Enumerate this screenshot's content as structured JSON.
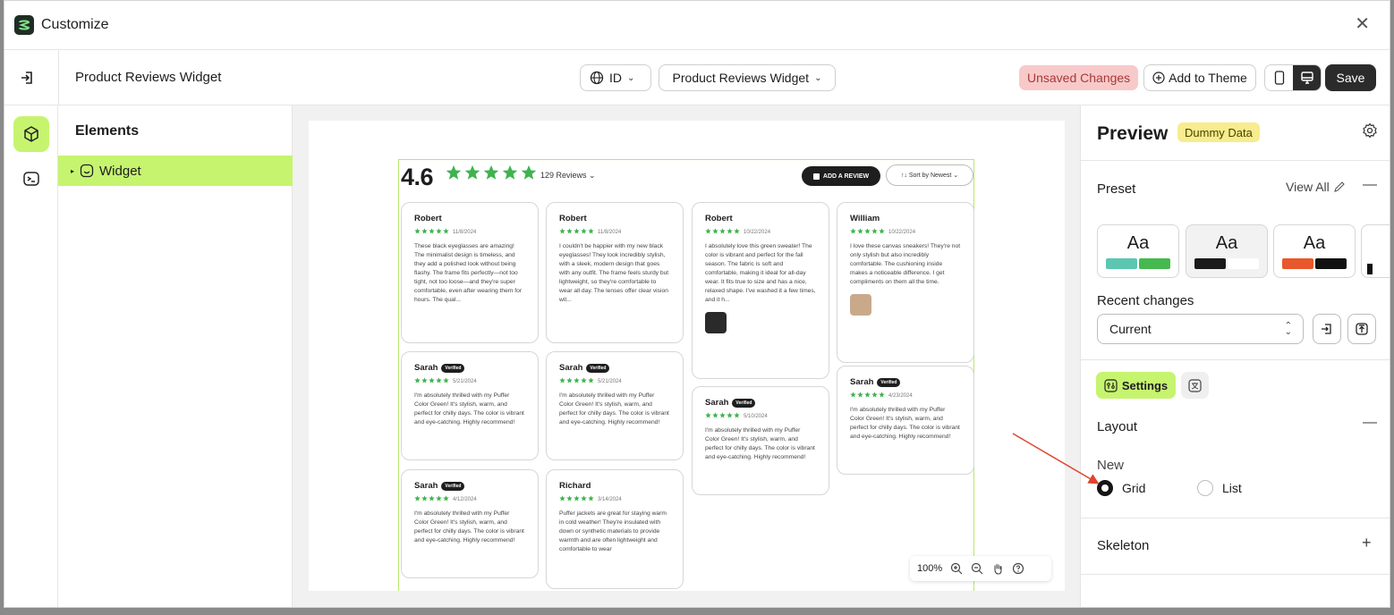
{
  "window": {
    "title": "Customize"
  },
  "header": {
    "widget_name": "Product Reviews Widget",
    "language": "ID",
    "widget_select": "Product Reviews Widget",
    "unsaved": "Unsaved Changes",
    "add_to_theme": "Add to Theme",
    "save": "Save"
  },
  "elements": {
    "title": "Elements",
    "tree": [
      {
        "label": "Widget"
      }
    ]
  },
  "widget": {
    "rating": "4.6",
    "review_count": "129 Reviews",
    "add_review": "ADD A REVIEW",
    "sort": "Sort by Newest",
    "verified_label": "Verified",
    "star_color": "#3fb34f",
    "reviews": [
      {
        "name": "Robert",
        "date": "11/8/2024",
        "text": "These black eyeglasses are amazing! The minimalist design is timeless, and they add a polished look without being flashy. The frame fits perfectly—not too tight, not too loose—and they're super comfortable, even after wearing them for hours. The qual..."
      },
      {
        "name": "Robert",
        "date": "11/8/2024",
        "text": "I couldn't be happier with my new black eyeglasses! They look incredibly stylish, with a sleek, modern design that goes with any outfit. The frame feels sturdy but lightweight, so they're comfortable to wear all day. The lenses offer clear vision wit..."
      },
      {
        "name": "Robert",
        "date": "10/22/2024",
        "text": "I absolutely love this green sweater! The color is vibrant and perfect for the fall season. The fabric is soft and comfortable, making it ideal for all-day wear. It fits true to size and has a nice, relaxed shape. I've washed it a few times, and it h..."
      },
      {
        "name": "William",
        "date": "10/22/2024",
        "text": "I love these canvas sneakers! They're not only stylish but also incredibly comfortable. The cushioning inside makes a noticeable difference. I get compliments on them all the time."
      },
      {
        "name": "Sarah",
        "date": "5/21/2024",
        "text": "I'm absolutely thrilled with my Puffer Color Green! It's stylish, warm, and perfect for chilly days. The color is vibrant and eye-catching. Highly recommend!"
      },
      {
        "name": "Sarah",
        "date": "5/21/2024",
        "text": "I'm absolutely thrilled with my Puffer Color Green! It's stylish, warm, and perfect for chilly days. The color is vibrant and eye-catching. Highly recommend!"
      },
      {
        "name": "Sarah",
        "date": "5/10/2024",
        "text": "I'm absolutely thrilled with my Puffer Color Green! It's stylish, warm, and perfect for chilly days. The color is vibrant and eye-catching. Highly recommend!"
      },
      {
        "name": "Sarah",
        "date": "4/23/2024",
        "text": "I'm absolutely thrilled with my Puffer Color Green! It's stylish, warm, and perfect for chilly days. The color is vibrant and eye-catching. Highly recommend!"
      },
      {
        "name": "Sarah",
        "date": "4/12/2024",
        "text": "I'm absolutely thrilled with my Puffer Color Green! It's stylish, warm, and perfect for chilly days. The color is vibrant and eye-catching. Highly recommend!"
      },
      {
        "name": "Richard",
        "date": "3/14/2024",
        "text": "Puffer jackets are great for staying warm in cold weather! They're insulated with down or synthetic materials to provide warmth and are often lightweight and comfortable to wear"
      }
    ]
  },
  "zoom": {
    "level": "100%"
  },
  "preview": {
    "title": "Preview",
    "badge": "Dummy Data",
    "preset_label": "Preset",
    "view_all": "View All",
    "presets": [
      {
        "text": "Aa",
        "colors": [
          "#5cc6b0",
          "#46b94e"
        ]
      },
      {
        "text": "Aa",
        "colors": [
          "#1a1a1a",
          "#ffffff"
        ]
      },
      {
        "text": "Aa",
        "colors": [
          "#e9572c",
          "#111111"
        ]
      }
    ],
    "recent_label": "Recent changes",
    "recent_value": "Current",
    "tab_settings": "Settings",
    "layout_label": "Layout",
    "new_label": "New",
    "opt_grid": "Grid",
    "opt_list": "List",
    "skeleton_label": "Skeleton"
  },
  "colors": {
    "accent": "#c6f46f",
    "dark": "#2b2b2b",
    "unsaved_bg": "#f8c9c9"
  }
}
